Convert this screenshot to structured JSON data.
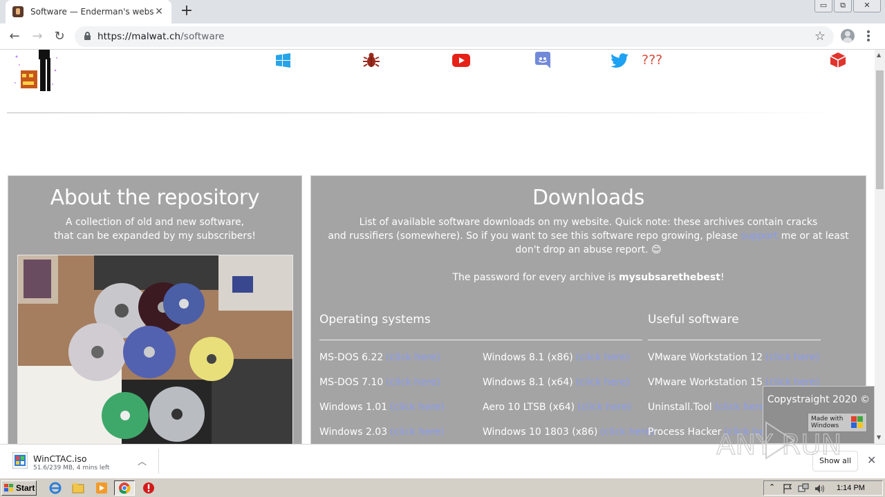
{
  "browser": {
    "tab_title": "Software — Enderman's website",
    "url_host": "https://malwat.ch",
    "url_path": "/software",
    "window_controls": {
      "minimize": "▭",
      "restore": "⧉",
      "close": "✕"
    }
  },
  "header": {
    "social_icons": [
      "windows-icon",
      "bug-icon",
      "youtube-icon",
      "discord-icon",
      "twitter-icon"
    ],
    "mystery_link": "???"
  },
  "about": {
    "title": "About the repository",
    "line1": "A collection of old and new software,",
    "line2": "that can be expanded by my subscribers!"
  },
  "downloads": {
    "title": "Downloads",
    "intro1": "List of available software downloads on my website. Quick note: these archives contain cracks",
    "intro2_pre": "and russifiers (somewhere). So if you want to see this software repo growing, please ",
    "intro2_link": "support",
    "intro2_post": " me or at least",
    "intro3": "don't drop an abuse report. 😊",
    "password_pre": "The password for every archive is ",
    "password": "mysubsarethebest",
    "password_post": "!",
    "link_label": "(click here)",
    "os_heading": "Operating systems",
    "useful_heading": "Useful software",
    "os_col1": [
      "MS-DOS 6.22",
      "MS-DOS 7.10",
      "Windows 1.01",
      "Windows 2.03"
    ],
    "os_col2": [
      "Windows 8.1 (x86)",
      "Windows 8.1 (x64)",
      "Aero 10 LTSB (x64)",
      "Windows 10 1803 (x86)"
    ],
    "useful_col": [
      "VMware Workstation 12",
      "VMware Workstation 15",
      "Uninstall.Tool",
      "Process Hacker"
    ]
  },
  "footer": {
    "copyright": "Copystraight 2020 ©",
    "badge_line1": "Made with",
    "badge_line2": "Windows"
  },
  "download_shelf": {
    "file_name": "WinCTAC.iso",
    "status": "51.6/239 MB, 4 mins left",
    "show_all": "Show all",
    "watermark": "ANY RUN"
  },
  "taskbar": {
    "start_label": "Start",
    "clock": "1:14 PM"
  }
}
